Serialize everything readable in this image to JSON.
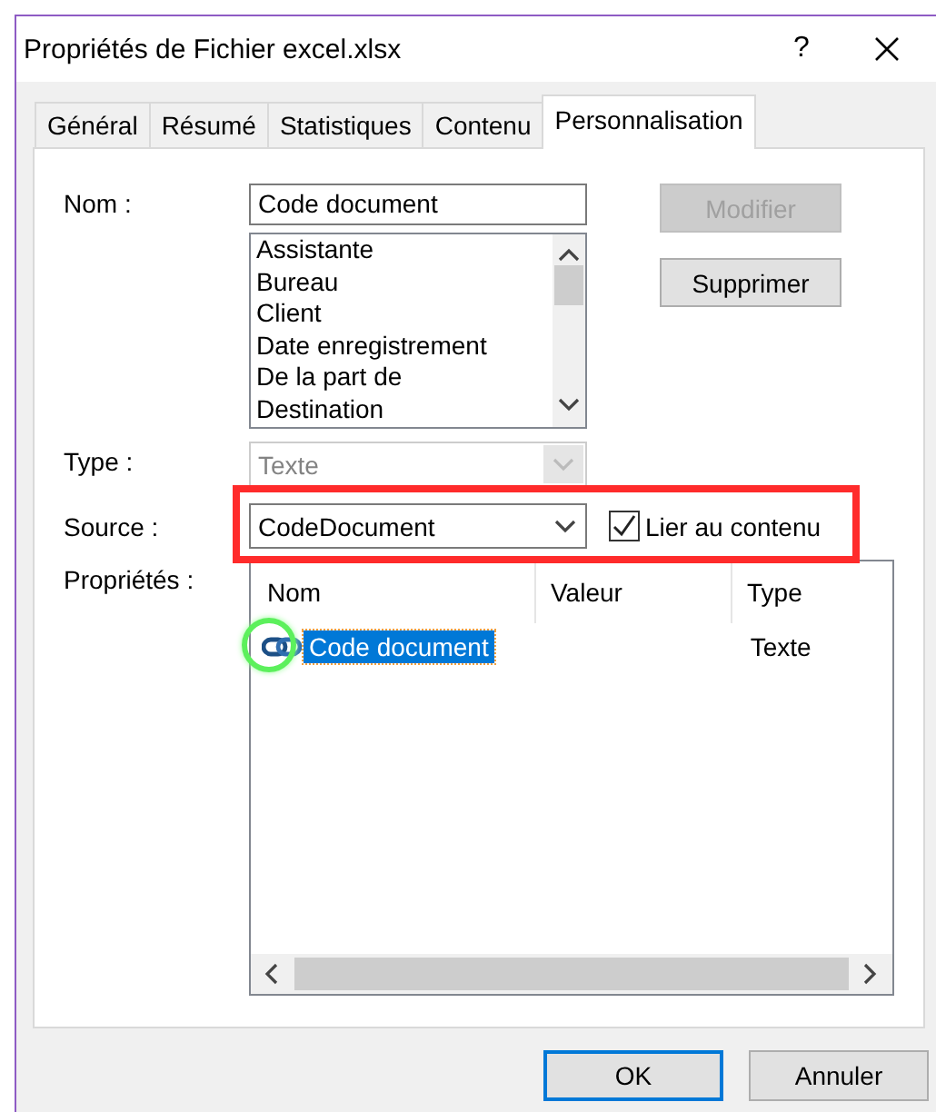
{
  "window": {
    "title": "Propriétés de Fichier excel.xlsx",
    "help": "?"
  },
  "tabs": [
    {
      "label": "Général",
      "selected": false
    },
    {
      "label": "Résumé",
      "selected": false
    },
    {
      "label": "Statistiques",
      "selected": false
    },
    {
      "label": "Contenu",
      "selected": false
    },
    {
      "label": "Personnalisation",
      "selected": true
    }
  ],
  "name_field": {
    "label": "Nom :",
    "value": "Code document"
  },
  "name_list": [
    "Assistante",
    "Bureau",
    "Client",
    "Date enregistrement",
    "De la part de",
    "Destination"
  ],
  "side_buttons": [
    {
      "label": "Modifier",
      "disabled": true
    },
    {
      "label": "Supprimer",
      "disabled": false
    }
  ],
  "type_field": {
    "label": "Type :",
    "value": "Texte",
    "disabled": true
  },
  "source_field": {
    "label": "Source :",
    "value": "CodeDocument",
    "disabled": false
  },
  "link_checkbox": {
    "label": "Lier au contenu",
    "checked": true
  },
  "properties": {
    "label": "Propriétés :",
    "columns": [
      "Nom",
      "Valeur",
      "Type"
    ],
    "rows": [
      {
        "name": "Code document",
        "value": "",
        "type": "Texte",
        "kind": "linked",
        "selected": true
      }
    ]
  },
  "buttons": [
    {
      "label": "OK",
      "default": true
    },
    {
      "label": "Annuler",
      "default": false
    }
  ]
}
